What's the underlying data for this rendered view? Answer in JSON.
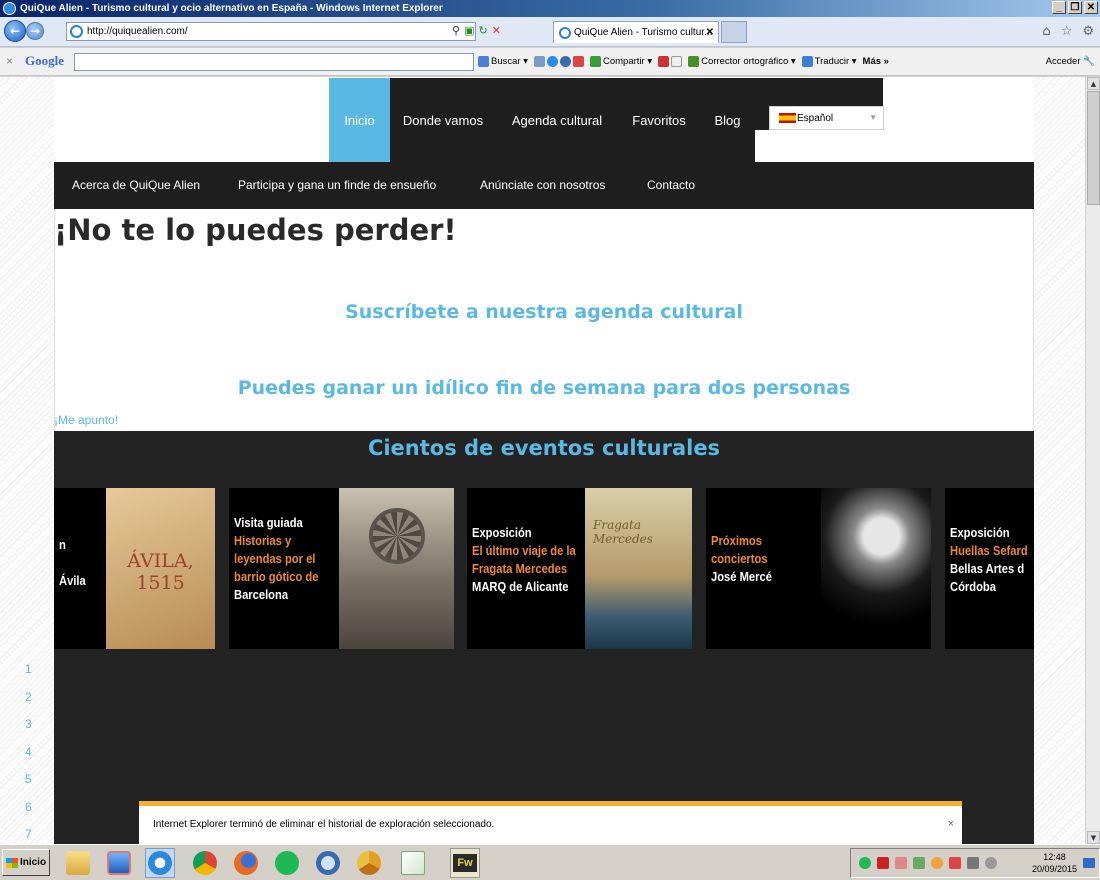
{
  "window": {
    "title": "QuiQue Alien - Turismo cultural y ocio alternativo en España - Windows Internet Explorer",
    "controls": [
      "_",
      "❐",
      "✕"
    ]
  },
  "browser": {
    "address": "http://quiquealien.com/",
    "tab_label": "QuiQue Alien - Turismo cultur...",
    "tab_close": "✕"
  },
  "google_toolbar": {
    "logo": "Google",
    "close": "×",
    "items": [
      "Buscar ▾",
      "Compartir ▾",
      "Corrector ortográfico ▾",
      "Traducir ▾",
      "Más »"
    ],
    "signin": "Acceder"
  },
  "site": {
    "main_nav": [
      {
        "label": "Inicio",
        "active": true
      },
      {
        "label": "Donde vamos",
        "active": false
      },
      {
        "label": "Agenda cultural",
        "active": false
      },
      {
        "label": "Favoritos",
        "active": false
      },
      {
        "label": "Blog",
        "active": false
      }
    ],
    "language": "Español",
    "sub_nav": [
      "Acerca de QuiQue Alien",
      "Participa y gana un finde de ensueño",
      "Anúnciate con nosotros",
      "Contacto"
    ],
    "headline": "¡No te lo puedes perder!",
    "cta_subscribe": "Suscríbete a nuestra agenda cultural",
    "cta_win": "Puedes ganar un idílico fin de semana para dos personas",
    "cta_link": "¡Me apunto!",
    "band_title": "Cientos de eventos culturales",
    "cards": [
      {
        "lines": [
          {
            "t": "n",
            "c": "w"
          },
          {
            "t": "",
            "c": "w"
          },
          {
            "t": "Ávila",
            "c": "w"
          }
        ],
        "image_text": "ÁVILA,\n1515"
      },
      {
        "lines": [
          {
            "t": "Visita guiada",
            "c": "w"
          },
          {
            "t": "Historias y",
            "c": "o"
          },
          {
            "t": "leyendas por el",
            "c": "o"
          },
          {
            "t": "barrio gótico de",
            "c": "o"
          },
          {
            "t": "Barcelona",
            "c": "w"
          }
        ]
      },
      {
        "lines": [
          {
            "t": "Exposición",
            "c": "w"
          },
          {
            "t": "El último viaje de la",
            "c": "o"
          },
          {
            "t": "Fragata Mercedes",
            "c": "o"
          },
          {
            "t": "MARQ de Alicante",
            "c": "w"
          }
        ],
        "image_text": "Fragata Mercedes"
      },
      {
        "lines": [
          {
            "t": "Próximos",
            "c": "o"
          },
          {
            "t": "conciertos",
            "c": "o"
          },
          {
            "t": "José Mercé",
            "c": "w"
          }
        ]
      },
      {
        "lines": [
          {
            "t": "Exposición",
            "c": "w"
          },
          {
            "t": "Huellas Sefard",
            "c": "o"
          },
          {
            "t": "Bellas Artes d",
            "c": "w"
          },
          {
            "t": "Córdoba",
            "c": "w"
          }
        ]
      }
    ],
    "pager": [
      "1",
      "2",
      "3",
      "4",
      "5",
      "6",
      "7"
    ]
  },
  "notification": {
    "message": "Internet Explorer terminó de eliminar el historial de exploración seleccionado.",
    "close": "×"
  },
  "taskbar": {
    "start_label": "Inicio",
    "clock_time": "12:48",
    "clock_date": "20/09/2015",
    "app_icon_label": "Fw"
  },
  "colors": {
    "accent": "#5ab9e2",
    "orange": "#f08a2c",
    "dark": "#1f1f1f"
  }
}
